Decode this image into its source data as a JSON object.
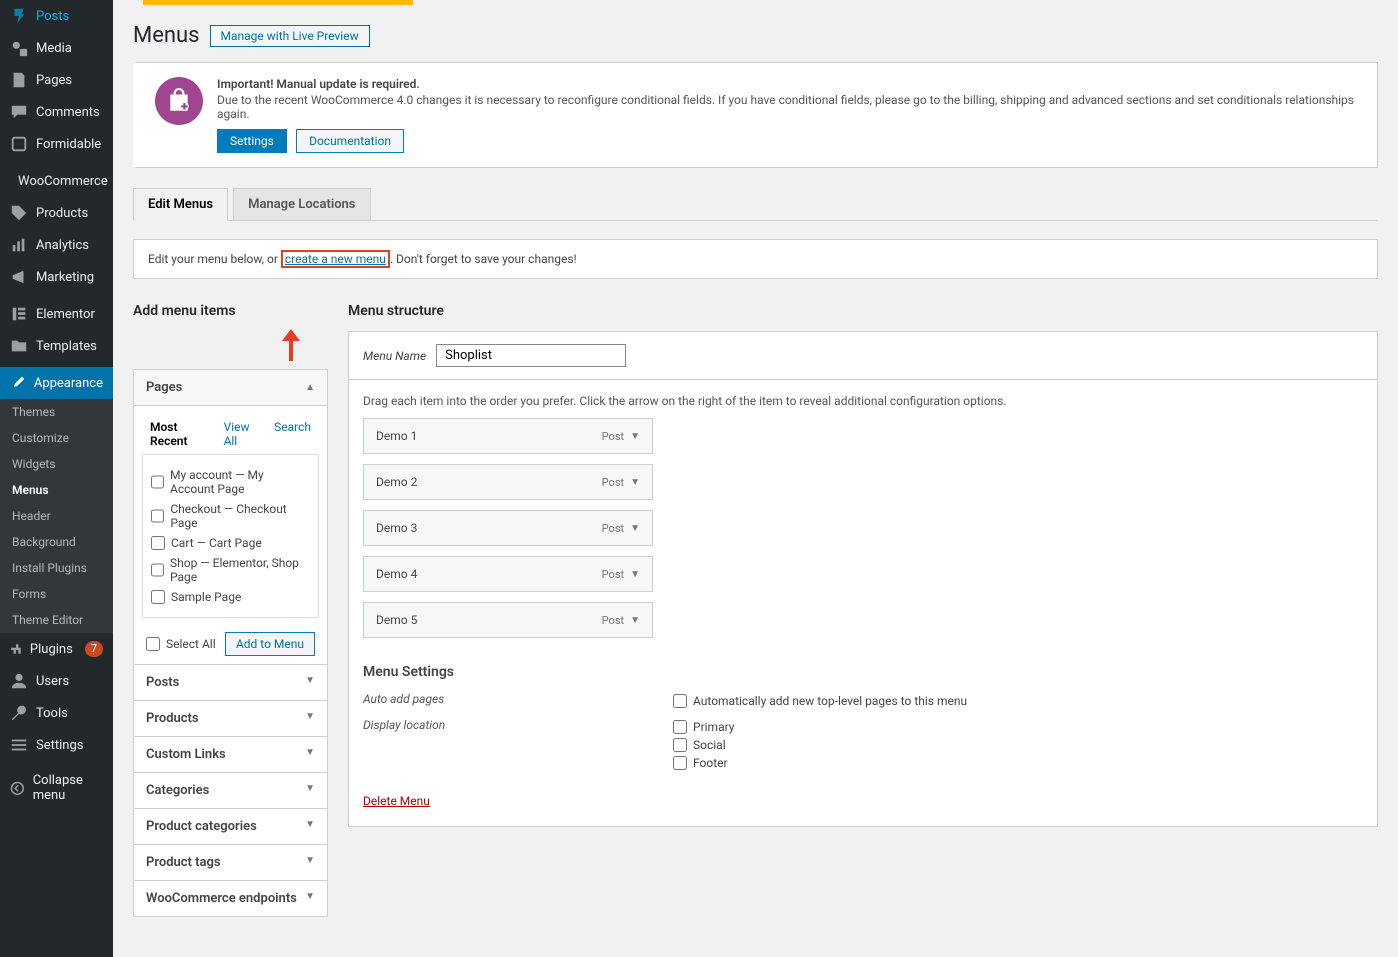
{
  "sidebar": {
    "items": [
      {
        "label": "Posts",
        "icon": "pin"
      },
      {
        "label": "Media",
        "icon": "media"
      },
      {
        "label": "Pages",
        "icon": "page"
      },
      {
        "label": "Comments",
        "icon": "comment"
      },
      {
        "label": "Formidable",
        "icon": "form"
      },
      {
        "label": "WooCommerce",
        "icon": "woo"
      },
      {
        "label": "Products",
        "icon": "product"
      },
      {
        "label": "Analytics",
        "icon": "chart"
      },
      {
        "label": "Marketing",
        "icon": "marketing"
      },
      {
        "label": "Elementor",
        "icon": "elementor"
      },
      {
        "label": "Templates",
        "icon": "templates"
      },
      {
        "label": "Appearance",
        "icon": "brush",
        "current": true
      },
      {
        "label": "Plugins",
        "icon": "plugin",
        "badge": "7"
      },
      {
        "label": "Users",
        "icon": "user"
      },
      {
        "label": "Tools",
        "icon": "tool"
      },
      {
        "label": "Settings",
        "icon": "settings"
      }
    ],
    "sub": [
      "Themes",
      "Customize",
      "Widgets",
      "Menus",
      "Header",
      "Background",
      "Install Plugins",
      "Forms",
      "Theme Editor"
    ],
    "sub_active": "Menus",
    "collapse": "Collapse menu"
  },
  "page": {
    "title": "Menus",
    "header_btn": "Manage with Live Preview"
  },
  "notice": {
    "title": "Important! Manual update is required.",
    "text": "Due to the recent WooCommerce 4.0 changes it is necessary to reconfigure conditional fields. If you have conditional fields, please go to the billing, shipping and advanced sections and set conditionals relationships again.",
    "btn_primary": "Settings",
    "btn_secondary": "Documentation"
  },
  "tabs": {
    "edit": "Edit Menus",
    "manage": "Manage Locations"
  },
  "info_row": {
    "before": "Edit your menu below, or ",
    "link": "create a new menu",
    "after": ". Don't forget to save your changes!"
  },
  "left": {
    "title": "Add menu items",
    "pages_header": "Pages",
    "subtabs": {
      "recent": "Most Recent",
      "view_all": "View All",
      "search": "Search"
    },
    "page_items": [
      "My account — My Account Page",
      "Checkout — Checkout Page",
      "Cart — Cart Page",
      "Shop — Elementor, Shop Page",
      "Sample Page"
    ],
    "select_all": "Select All",
    "add_btn": "Add to Menu",
    "collapsed": [
      "Posts",
      "Products",
      "Custom Links",
      "Categories",
      "Product categories",
      "Product tags",
      "WooCommerce endpoints"
    ]
  },
  "right": {
    "title": "Menu structure",
    "name_label": "Menu Name",
    "name_value": "Shoplist",
    "drag_text": "Drag each item into the order you prefer. Click the arrow on the right of the item to reveal additional configuration options.",
    "items": [
      {
        "label": "Demo 1",
        "type": "Post"
      },
      {
        "label": "Demo 2",
        "type": "Post"
      },
      {
        "label": "Demo 3",
        "type": "Post"
      },
      {
        "label": "Demo 4",
        "type": "Post"
      },
      {
        "label": "Demo 5",
        "type": "Post"
      }
    ],
    "settings_title": "Menu Settings",
    "auto_add_label": "Auto add pages",
    "auto_add_opt": "Automatically add new top-level pages to this menu",
    "display_label": "Display location",
    "locations": [
      "Primary",
      "Social",
      "Footer"
    ],
    "delete": "Delete Menu"
  }
}
